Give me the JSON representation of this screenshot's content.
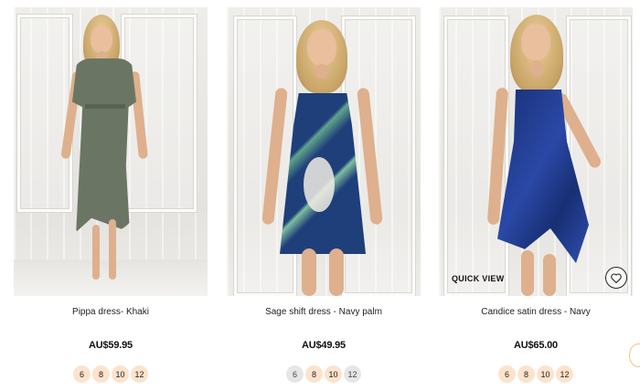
{
  "products": [
    {
      "name": "Pippa dress- Khaki",
      "price": "AU$59.95",
      "sizes": [
        {
          "label": "6",
          "available": true
        },
        {
          "label": "8",
          "available": true
        },
        {
          "label": "10",
          "available": true
        },
        {
          "label": "12",
          "available": true
        }
      ],
      "dress_color": "#6b7563"
    },
    {
      "name": "Sage shift dress - Navy palm",
      "price": "AU$49.95",
      "sizes": [
        {
          "label": "6",
          "available": false
        },
        {
          "label": "8",
          "available": true
        },
        {
          "label": "10",
          "available": true
        },
        {
          "label": "12",
          "available": false
        }
      ],
      "dress_color": "#1f3f7a"
    },
    {
      "name": "Candice satin dress - Navy",
      "price": "AU$65.00",
      "quick_view_label": "QUICK VIEW",
      "wishlist_icon": "heart-icon",
      "sizes": [
        {
          "label": "6",
          "available": true
        },
        {
          "label": "8",
          "available": true
        },
        {
          "label": "10",
          "available": true
        },
        {
          "label": "12",
          "available": true
        }
      ],
      "dress_color": "#213a8c"
    }
  ],
  "colors": {
    "size_available": "#fde3cc",
    "size_unavailable": "#e6e6e6",
    "edge_accent": "#f1c27a"
  }
}
